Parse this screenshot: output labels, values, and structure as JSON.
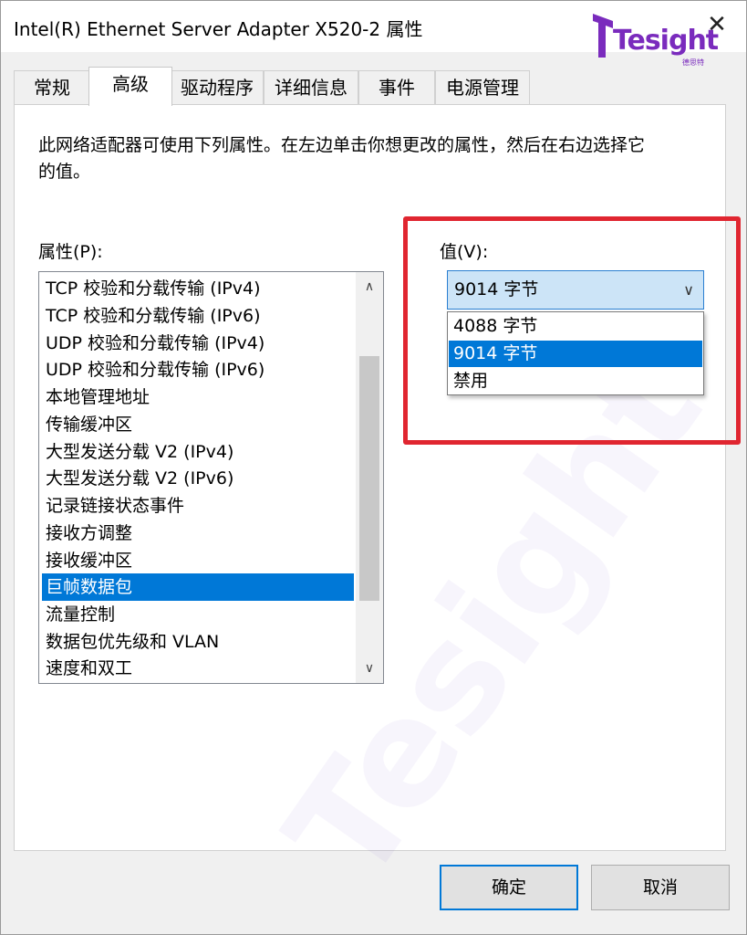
{
  "window": {
    "title": "Intel(R) Ethernet Server Adapter X520-2 属性",
    "close_glyph": "✕"
  },
  "logo": {
    "text": "Tesight",
    "sub": "德思特"
  },
  "tabs": [
    {
      "label": "常规"
    },
    {
      "label": "高级"
    },
    {
      "label": "驱动程序"
    },
    {
      "label": "详细信息"
    },
    {
      "label": "事件"
    },
    {
      "label": "电源管理"
    }
  ],
  "active_tab": "高级",
  "description": "此网络适配器可使用下列属性。在左边单击你想更改的属性，然后在右边选择它的值。",
  "properties": {
    "label": "属性(P):",
    "items": [
      "TCP 校验和分载传输 (IPv4)",
      "TCP 校验和分载传输 (IPv6)",
      "UDP 校验和分载传输 (IPv4)",
      "UDP 校验和分载传输 (IPv6)",
      "本地管理地址",
      "传输缓冲区",
      "大型发送分载 V2 (IPv4)",
      "大型发送分载 V2 (IPv6)",
      "记录链接状态事件",
      "接收方调整",
      "接收缓冲区",
      "巨帧数据包",
      "流量控制",
      "数据包优先级和 VLAN",
      "速度和双工"
    ],
    "selected": "巨帧数据包"
  },
  "value": {
    "label": "值(V):",
    "current": "9014 字节",
    "options": [
      "4088 字节",
      "9014 字节",
      "禁用"
    ],
    "selected": "9014 字节"
  },
  "buttons": {
    "ok": "确定",
    "cancel": "取消"
  },
  "colors": {
    "selection": "#0078d7",
    "highlight_box": "#e02630",
    "logo": "#7a2bbd"
  }
}
